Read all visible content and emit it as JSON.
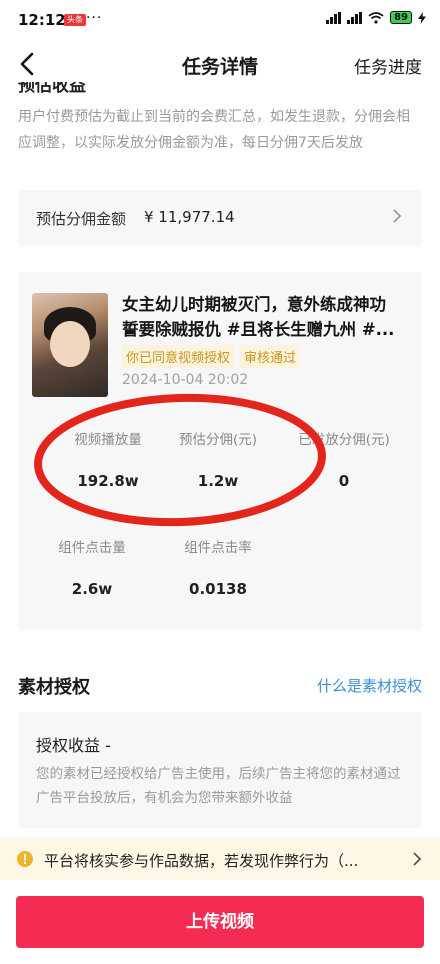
{
  "status_bar": {
    "time": "12:12",
    "badge": "头条",
    "dots": "···",
    "network": "HD",
    "battery": "89"
  },
  "nav": {
    "title": "任务详情",
    "progress_link": "任务进度"
  },
  "notice": {
    "partial_heading": "预估收益",
    "text": "用户付费预估为截止到当前的会费汇总，如发生退款，分佣会相应调整，以实际发放分佣金额为准，每日分佣7天后发放"
  },
  "amount": {
    "label": "预估分佣金额",
    "value": "¥ 11,977.14"
  },
  "task": {
    "title_line1": "女主幼儿时期被灭门，意外练成神功",
    "title_line2": "誓要除贼报仇 #且将长生赠九州 #...",
    "tags": [
      "你已同意视频授权",
      "审核通过"
    ],
    "date": "2024-10-04 20:02",
    "stats_row1": [
      {
        "label": "视频播放量",
        "value": "192.8w"
      },
      {
        "label": "预估分佣(元)",
        "value": "1.2w"
      },
      {
        "label": "已发放分佣(元)",
        "value": "0"
      }
    ],
    "stats_row2": [
      {
        "label": "组件点击量",
        "value": "2.6w"
      },
      {
        "label": "组件点击率",
        "value": "0.0138"
      }
    ]
  },
  "material": {
    "title": "素材授权",
    "link": "什么是素材授权",
    "income_title": "授权收益 -",
    "income_desc": "您的素材已经授权给广告主使用，后续广告主将您的素材通过广告平台投放后，有机会为您带来额外收益"
  },
  "warning": {
    "text": "平台将核实参与作品数据，若发现作弊行为（..."
  },
  "upload_button": "上传视频",
  "colors": {
    "accent": "#f42c54",
    "link": "#3c8fd8",
    "tag_text": "#c99620",
    "annotation": "#e3261c"
  }
}
